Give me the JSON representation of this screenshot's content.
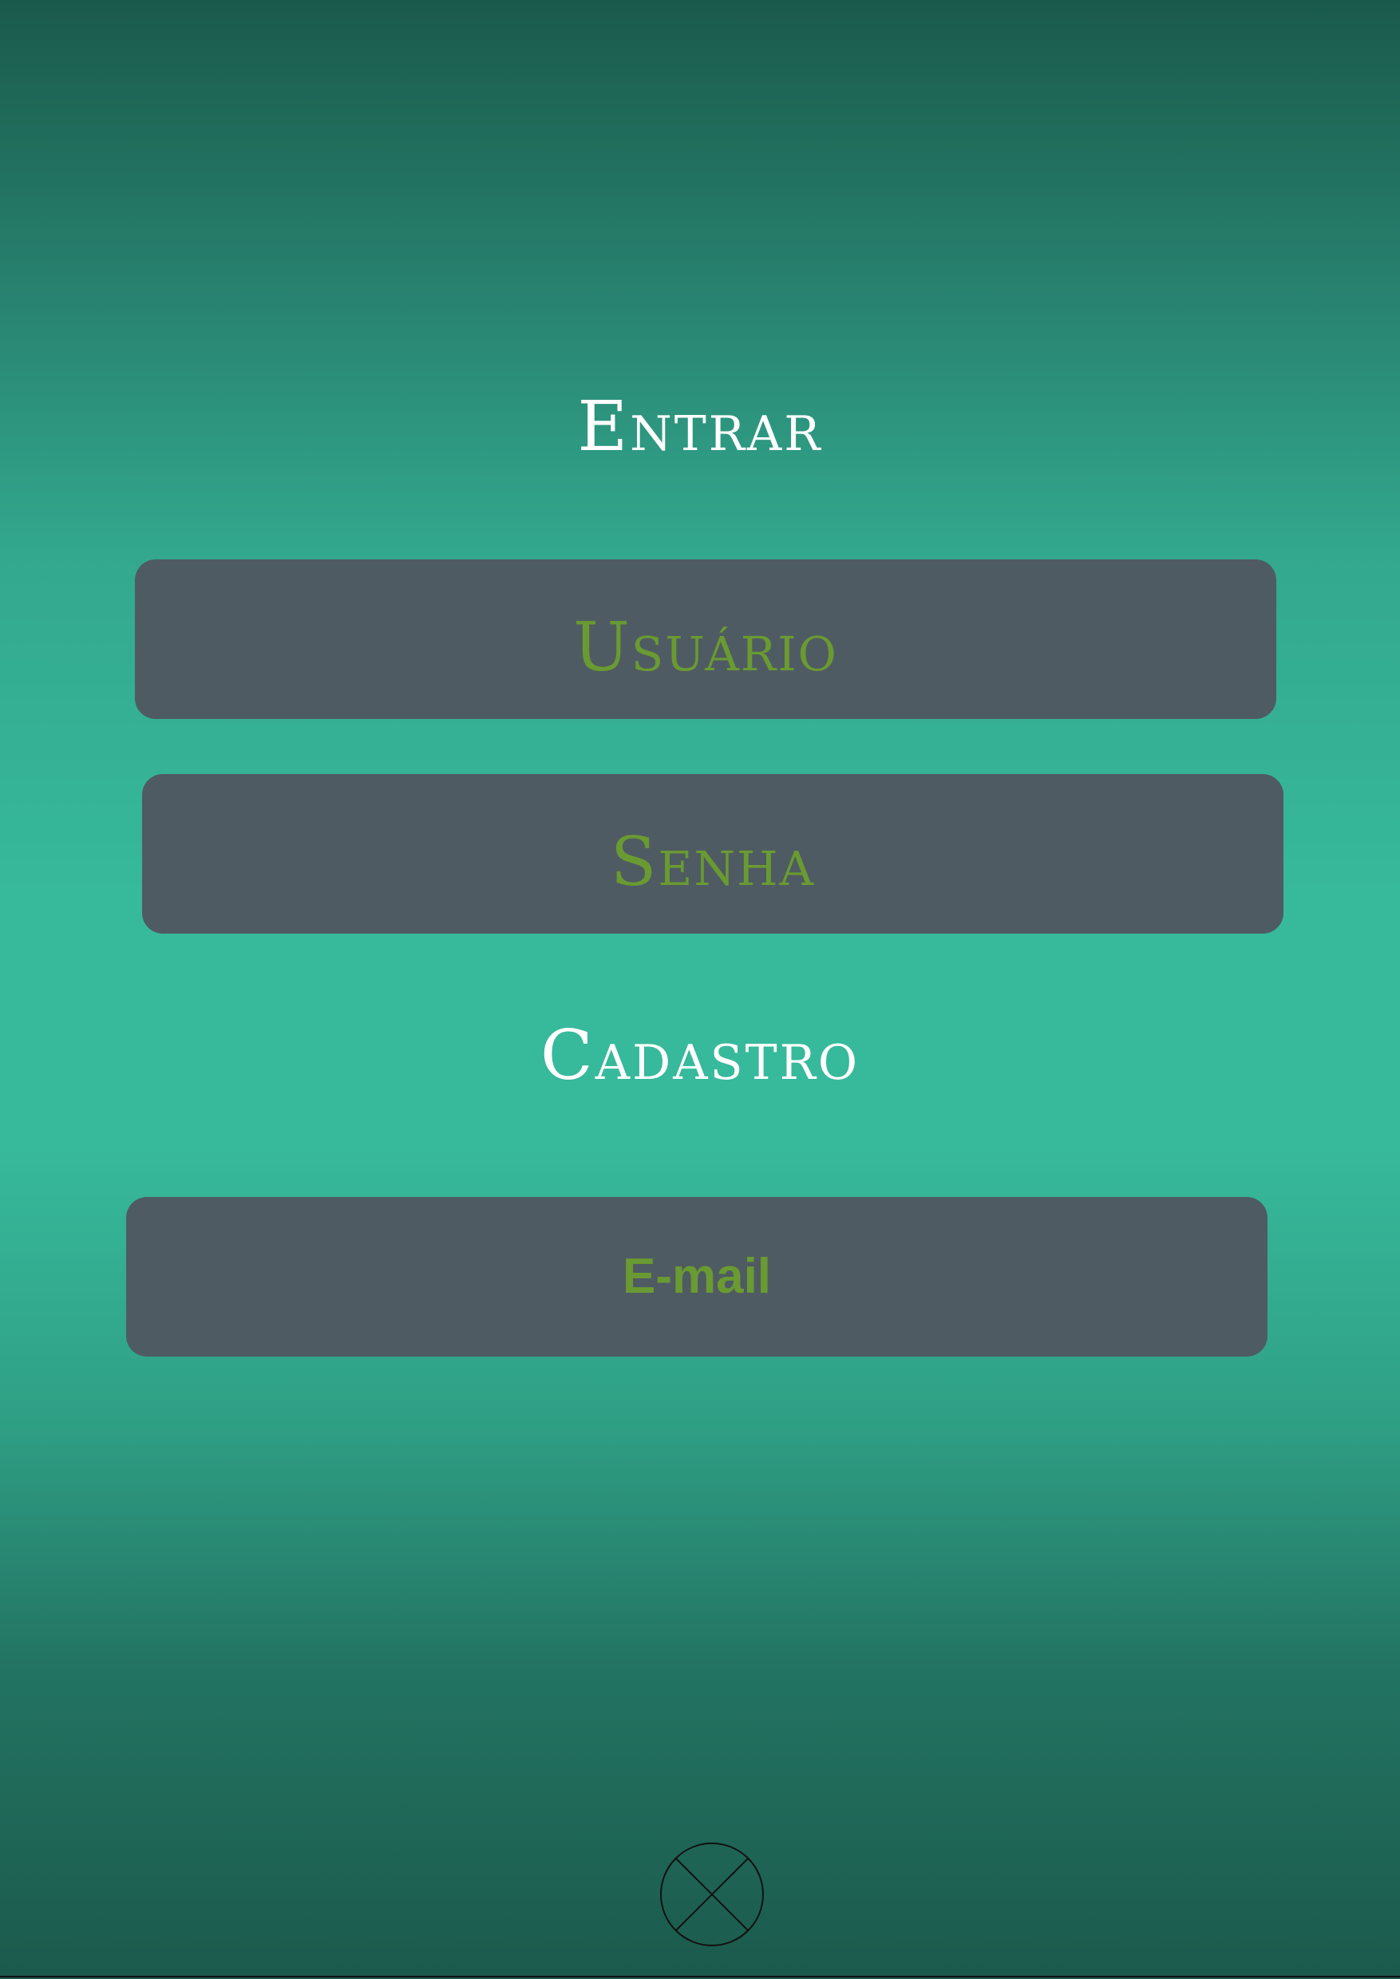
{
  "login": {
    "title": "Entrar",
    "username_placeholder": "Usuário",
    "password_placeholder": "Senha"
  },
  "signup": {
    "title": "Cadastro",
    "email_placeholder": "E-mail"
  },
  "footer": {
    "close_icon": "circle-x-icon"
  },
  "colors": {
    "background_top": "#1a5a4c",
    "background_mid": "#37b99b",
    "field_background": "#4f5b62",
    "field_text": "#6a9a32",
    "heading_text": "#ffffff"
  }
}
